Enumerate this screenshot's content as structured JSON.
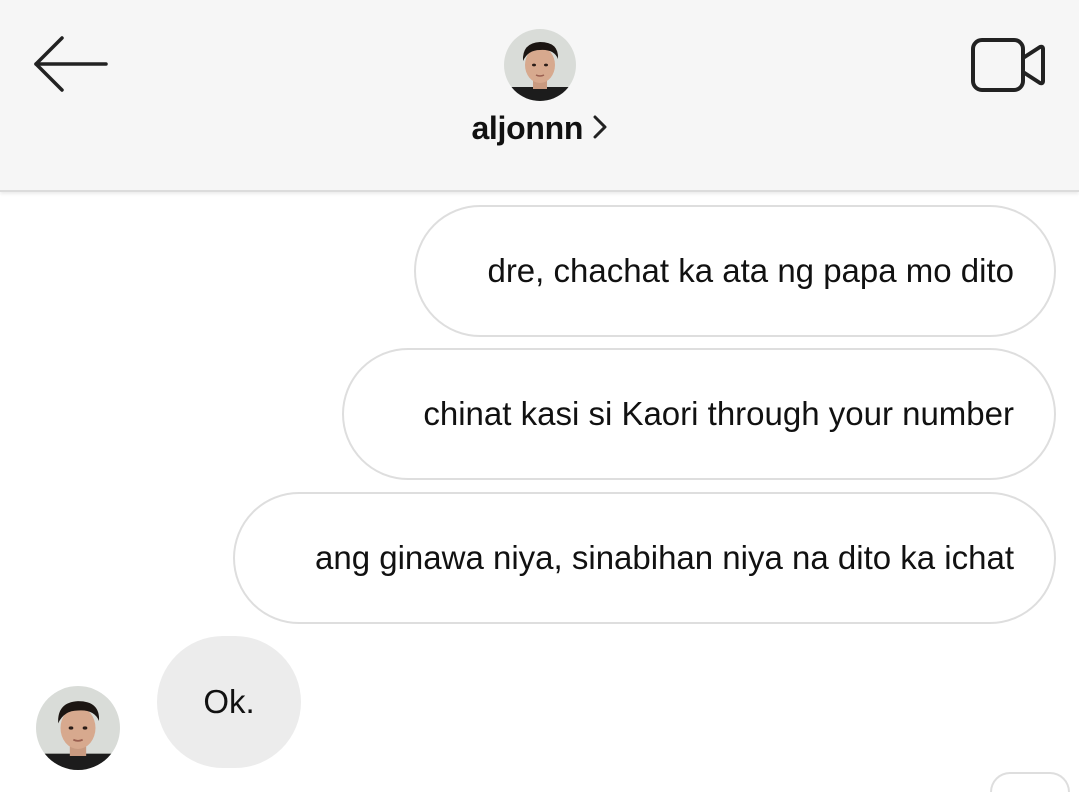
{
  "header": {
    "username": "aljonnn",
    "back_icon": "arrow-left-icon",
    "video_icon": "video-camera-icon",
    "chevron_icon": "chevron-right-icon"
  },
  "messages": [
    {
      "direction": "outgoing",
      "text": "dre, chachat ka ata ng papa mo dito"
    },
    {
      "direction": "outgoing",
      "text": "chinat kasi si Kaori through your number"
    },
    {
      "direction": "outgoing",
      "text": "ang ginawa niya, sinabihan niya na dito ka ichat"
    },
    {
      "direction": "incoming",
      "text": "Ok."
    }
  ],
  "colors": {
    "header_bg": "#f6f6f6",
    "outgoing_border": "#dedede",
    "incoming_bg": "#ececec",
    "text": "#111111"
  }
}
